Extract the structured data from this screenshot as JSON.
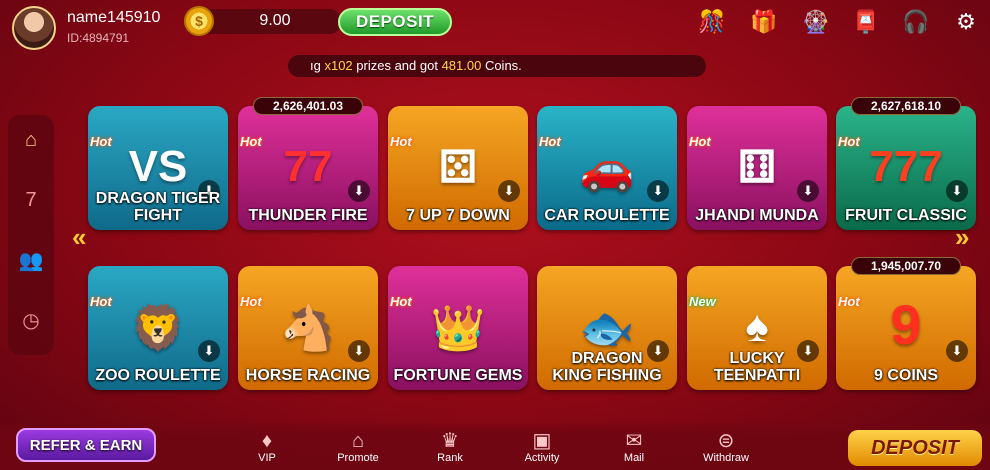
{
  "header": {
    "username": "name145910",
    "user_id": "ID:4894791",
    "balance": "9.00",
    "deposit_label": "DEPOSIT"
  },
  "marquee": {
    "prefix": "ıg ",
    "multiplier": "x102",
    "middle": " prizes and got ",
    "amount": "481.00",
    "suffix": " Coins."
  },
  "games": [
    {
      "name": "DRAGON TIGER  FIGHT",
      "badge": "Hot",
      "jackpot": "",
      "art": "VS"
    },
    {
      "name": "THUNDER FIRE",
      "badge": "Hot",
      "jackpot": "2,626,401.03",
      "art": "77"
    },
    {
      "name": "7 UP 7 DOWN",
      "badge": "Hot",
      "jackpot": "",
      "art": "⚄"
    },
    {
      "name": "CAR ROULETTE",
      "badge": "Hot",
      "jackpot": "",
      "art": "🚗"
    },
    {
      "name": "JHANDI MUNDA",
      "badge": "Hot",
      "jackpot": "",
      "art": "⚅"
    },
    {
      "name": "FRUIT CLASSIC",
      "badge": "Hot",
      "jackpot": "2,627,618.10",
      "art": "777"
    },
    {
      "name": "ZOO ROULETTE",
      "badge": "Hot",
      "jackpot": "",
      "art": "🦁"
    },
    {
      "name": "HORSE RACING",
      "badge": "Hot",
      "jackpot": "",
      "art": "🐴"
    },
    {
      "name": "FORTUNE GEMS",
      "badge": "Hot",
      "jackpot": "",
      "art": "👑"
    },
    {
      "name": "DRAGON KING FISHING",
      "badge": "",
      "jackpot": "",
      "art": "🐟"
    },
    {
      "name": "LUCKY TEENPATTI",
      "badge": "New",
      "jackpot": "",
      "art": "♠"
    },
    {
      "name": "9 COINS",
      "badge": "Hot",
      "jackpot": "1,945,007.70",
      "art": "9"
    }
  ],
  "bottom_nav": {
    "refer": "REFER & EARN",
    "items": [
      "VIP",
      "Promote",
      "Rank",
      "Activity",
      "Mail",
      "Withdraw"
    ],
    "deposit": "DEPOSIT"
  },
  "colors": {
    "background": "#8a0714",
    "accent_green": "#1f9a2a",
    "accent_gold": "#ffd84a"
  }
}
